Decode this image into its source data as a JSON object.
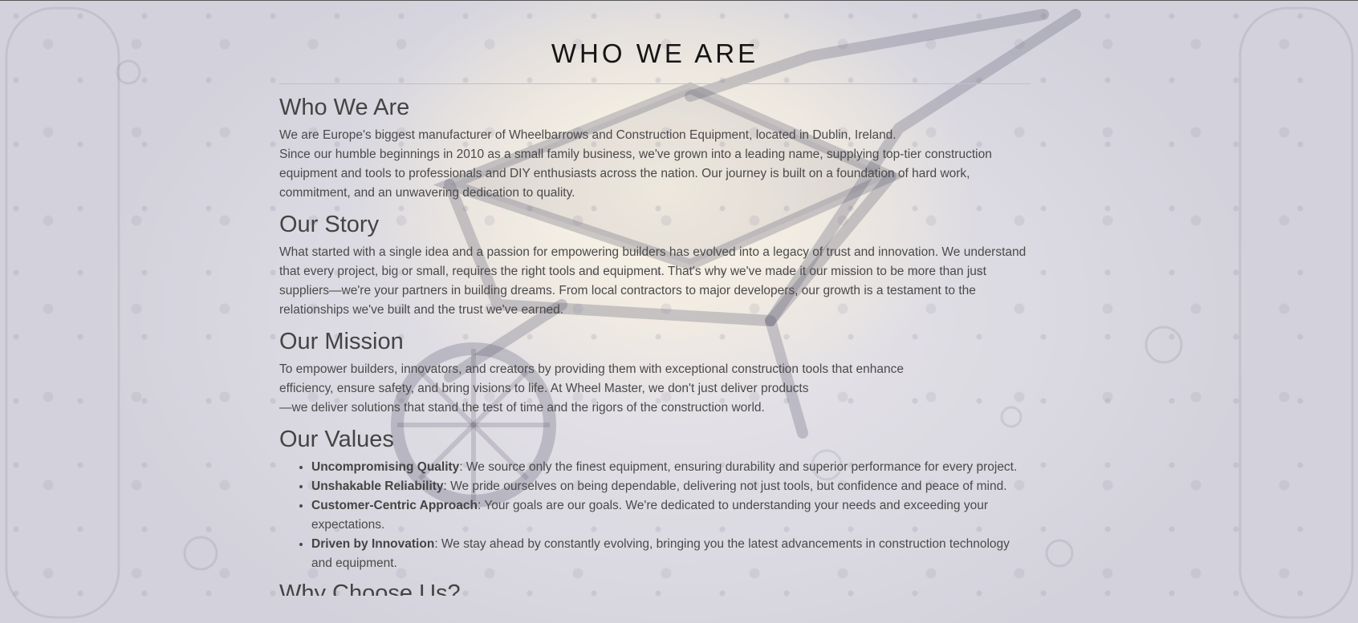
{
  "page_title": "WHO WE ARE",
  "sections": {
    "who": {
      "heading": "Who We Are",
      "line1": "We are Europe's biggest manufacturer of Wheelbarrows and Construction Equipment, located in Dublin, Ireland.",
      "line2": "Since our humble beginnings in 2010 as a small family business, we've grown into a leading name, supplying top-tier construction equipment and tools to professionals and DIY enthusiasts across the nation. Our journey is built on a foundation of hard work, commitment, and an unwavering dedication to quality."
    },
    "story": {
      "heading": "Our Story",
      "text": "What started with a single idea and a passion for empowering builders has evolved into a legacy of trust and innovation. We understand that every project, big or small, requires the right tools and equipment. That's why we've made it our mission to be more than just suppliers—we're your partners in building dreams. From local contractors to major developers, our growth is a testament to the relationships we've built and the trust we've earned."
    },
    "mission": {
      "heading": "Our Mission",
      "line1": "To empower builders, innovators, and creators by providing them with exceptional construction tools that enhance",
      "line2": "efficiency, ensure safety, and bring visions to life. At Wheel Master, we don't just deliver products",
      "line3": "—we deliver solutions that stand the test of time and the rigors of the construction world."
    },
    "values": {
      "heading": "Our Values",
      "items": [
        {
          "title": "Uncompromising Quality",
          "text": ": We source only the finest equipment, ensuring durability and superior performance for every project."
        },
        {
          "title": "Unshakable Reliability",
          "text": ": We pride ourselves on being dependable, delivering not just tools, but confidence and peace of mind."
        },
        {
          "title": "Customer-Centric Approach",
          "text": ": Your goals are our goals. We're dedicated to understanding your needs and exceeding your expectations."
        },
        {
          "title": "Driven by Innovation",
          "text": ": We stay ahead by constantly evolving, bringing you the latest advancements in construction technology and equipment."
        }
      ]
    },
    "choose": {
      "heading": "Why Choose Us?"
    }
  },
  "background": {
    "icon": "wheelbarrow-illustration",
    "accent": "#f6eedc"
  }
}
